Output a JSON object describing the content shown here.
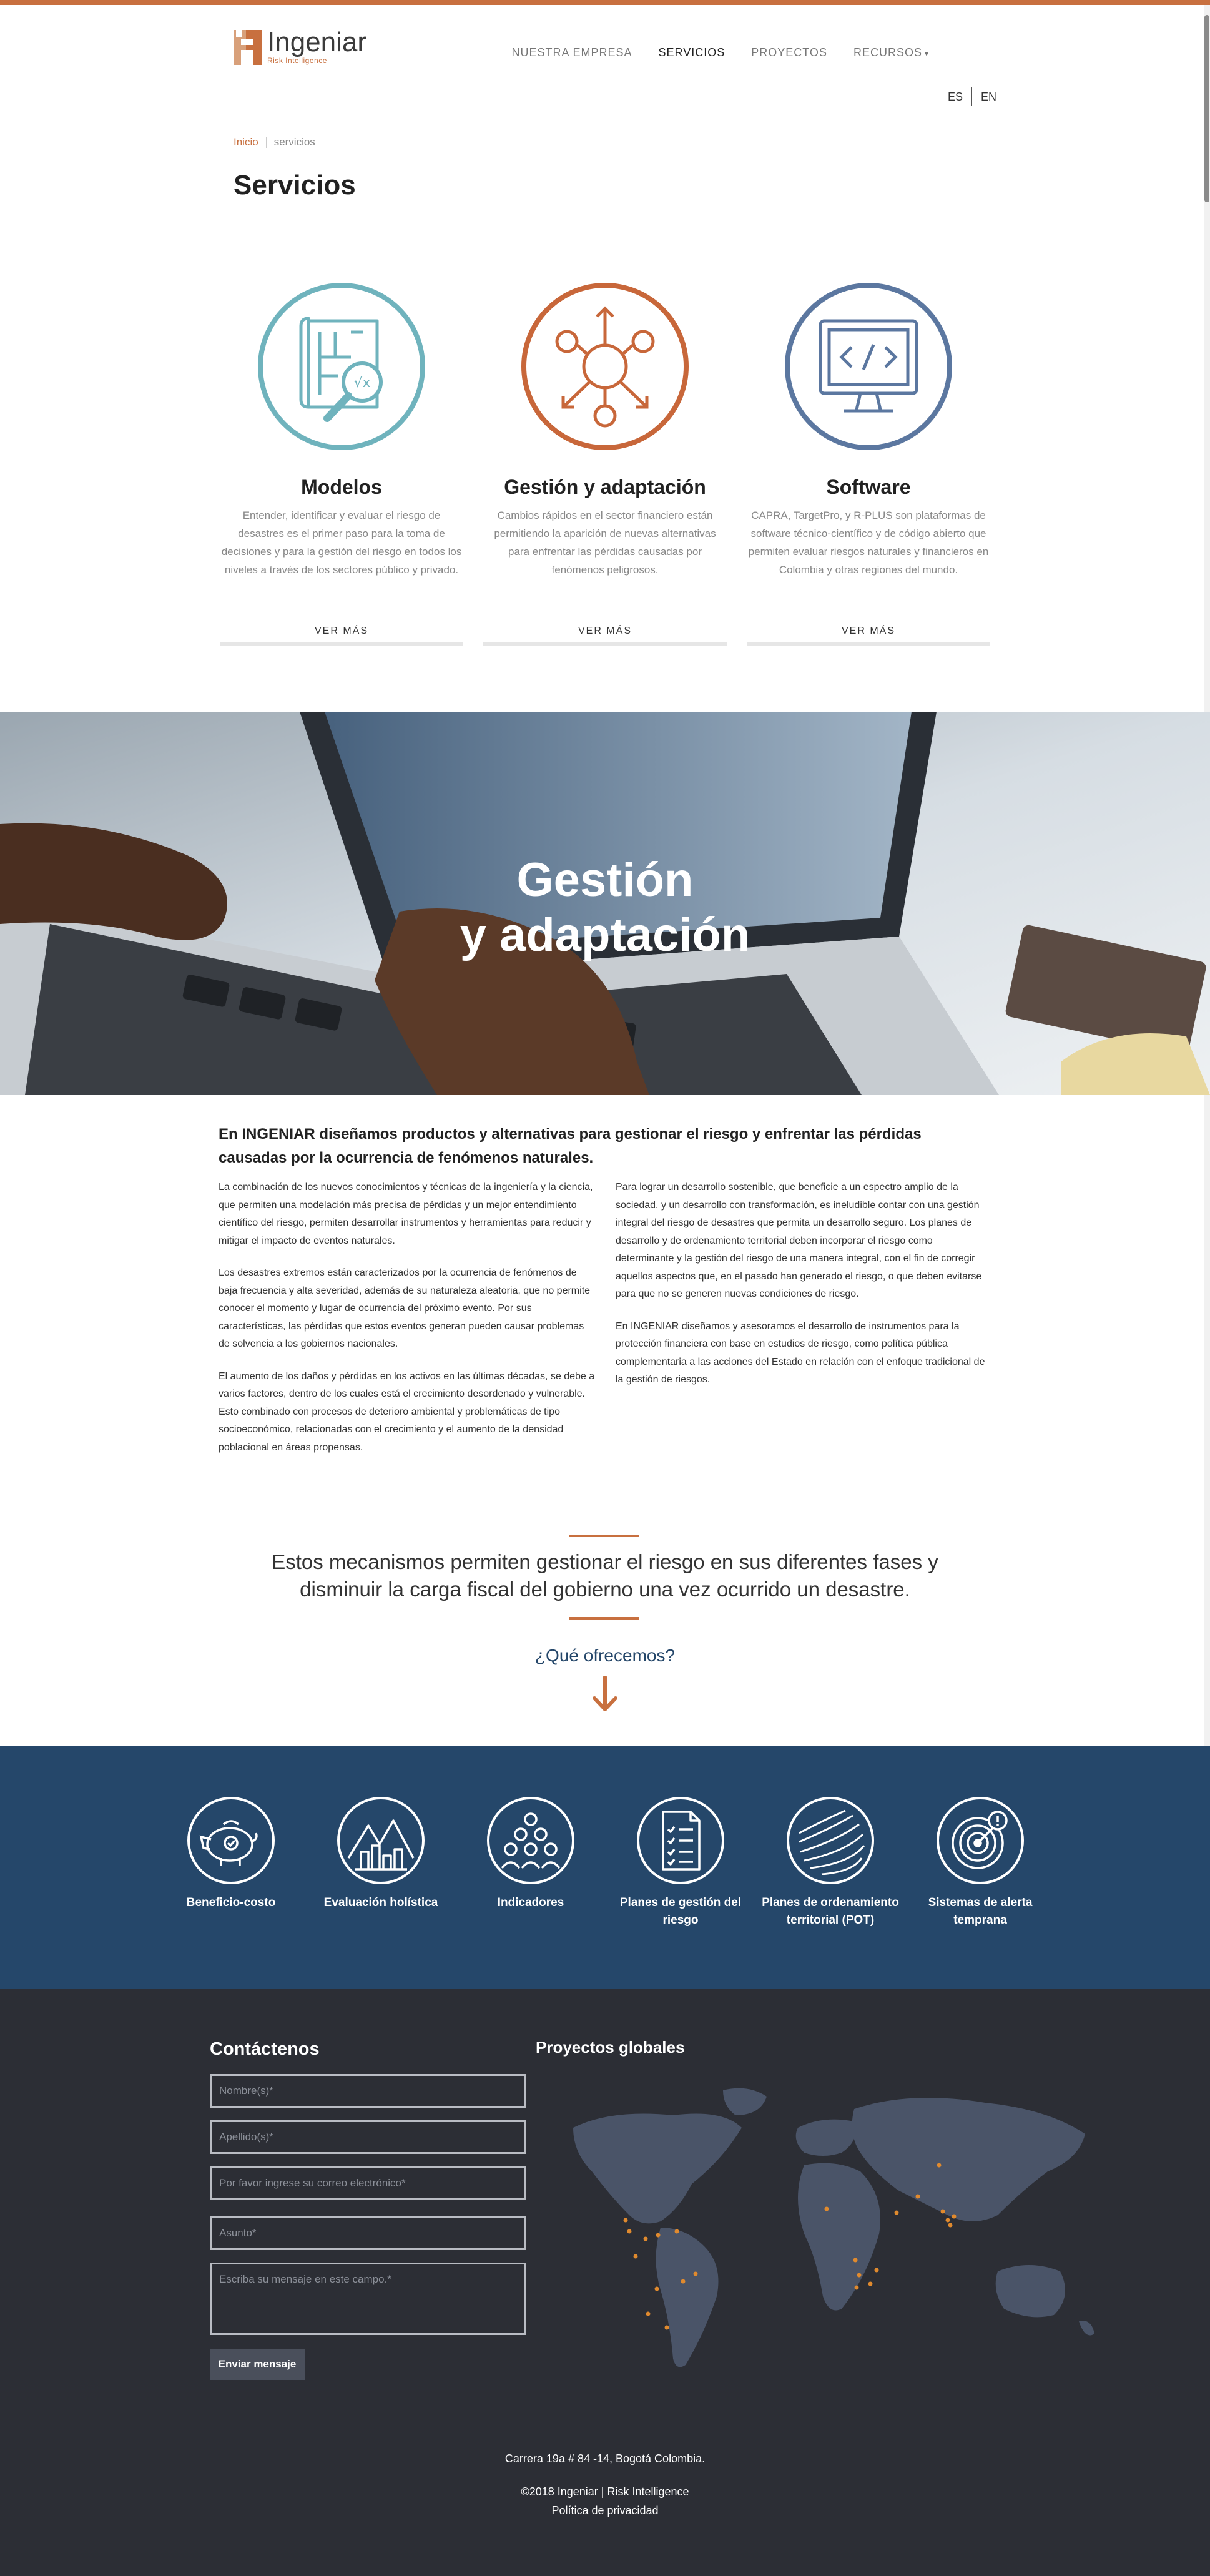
{
  "brand": {
    "name": "Ingeniar",
    "tagline": "Risk Intelligence",
    "accent_color": "#c8703f",
    "navy_color": "#25476a"
  },
  "nav": {
    "items": [
      {
        "label": "NUESTRA EMPRESA",
        "active": false
      },
      {
        "label": "SERVICIOS",
        "active": true
      },
      {
        "label": "PROYECTOS",
        "active": false
      },
      {
        "label": "RECURSOS",
        "active": false,
        "has_dropdown": true
      }
    ],
    "dropdown_icon": "chevron-down-icon"
  },
  "lang": {
    "es": "ES",
    "en": "EN"
  },
  "breadcrumb": {
    "home": "Inicio",
    "current": "servicios"
  },
  "page_title": "Servicios",
  "services": [
    {
      "icon": "blueprint-magnifier-icon",
      "color": "#6fb3bd",
      "title": "Modelos",
      "text": "Entender, identificar y evaluar el riesgo de desastres es el primer paso para la toma de decisiones y para la gestión del riesgo en todos los niveles a través de los sectores público y privado.",
      "button": "VER MÁS"
    },
    {
      "icon": "network-hub-icon",
      "color": "#c8673a",
      "title": "Gestión y adaptación",
      "text": "Cambios rápidos en el sector financiero están permitiendo la aparición de nuevas alternativas para enfrentar las pérdidas causadas por fenómenos peligrosos.",
      "button": "VER MÁS"
    },
    {
      "icon": "monitor-code-icon",
      "color": "#5b77a0",
      "title": "Software",
      "text": "CAPRA, TargetPro, y R-PLUS son plataformas de software técnico-científico y de código abierto que permiten evaluar riesgos naturales y financieros en Colombia y otras regiones del mundo.",
      "button": "VER MÁS"
    }
  ],
  "hero": {
    "line1": "Gestión",
    "line2": "y adaptación"
  },
  "article": {
    "lead": "En INGENIAR diseñamos productos y alternativas para gestionar el riesgo y enfrentar las pérdidas causadas por la ocurrencia de fenómenos naturales.",
    "left": [
      "La combinación de los nuevos conocimientos y técnicas de la ingeniería y la ciencia, que permiten una modelación más precisa de pérdidas y un mejor entendimiento científico del riesgo, permiten desarrollar instrumentos y herramientas para reducir y mitigar el impacto de eventos naturales.",
      "Los desastres extremos están caracterizados por la ocurrencia de fenómenos de baja frecuencia y alta severidad, además de su naturaleza aleatoria, que no permite conocer el momento y lugar de ocurrencia del próximo evento. Por sus características, las pérdidas que estos eventos generan pueden causar problemas de solvencia a los gobiernos nacionales.",
      "El aumento de los daños y pérdidas en los activos en las últimas décadas, se debe a varios factores, dentro de los cuales está el crecimiento desordenado y vulnerable. Esto combinado con procesos de deterioro ambiental y problemáticas de tipo socioeconómico, relacionadas con el crecimiento y el aumento de la densidad poblacional en áreas propensas."
    ],
    "right": [
      "Para lograr un desarrollo sostenible, que beneficie a un espectro amplio de la sociedad, y un desarrollo con transformación, es ineludible contar con una gestión integral del riesgo de desastres que permita un desarrollo seguro. Los planes de desarrollo y de ordenamiento territorial deben incorporar el riesgo como determinante y la gestión del riesgo de una manera integral, con el fin de corregir aquellos aspectos que, en el pasado han generado el riesgo, o que deben evitarse para que no se generen nuevas condiciones de riesgo.",
      "En INGENIAR diseñamos y asesoramos el desarrollo de instrumentos para la protección financiera con base en estudios de riesgo, como política pública complementaria a las acciones del Estado en relación con el enfoque tradicional de la gestión de riesgos."
    ],
    "quote": "Estos mecanismos permiten gestionar el riesgo en sus diferentes fases y disminuir la carga fiscal del gobierno una vez ocurrido un desastre.",
    "offer": "¿Qué ofrecemos?",
    "offer_icon": "arrow-down-icon"
  },
  "features": [
    {
      "label": "Beneficio-costo",
      "icon": "piggy-bank-icon"
    },
    {
      "label": "Evaluación holística",
      "icon": "city-mountains-icon"
    },
    {
      "label": "Indicadores",
      "icon": "people-group-icon"
    },
    {
      "label": "Planes de gestión del riesgo",
      "icon": "checklist-document-icon"
    },
    {
      "label": "Planes de ordenamiento territorial (POT)",
      "icon": "topographic-lines-icon"
    },
    {
      "label": "Sistemas de alerta temprana",
      "icon": "radar-alert-icon"
    }
  ],
  "contact": {
    "title": "Contáctenos",
    "first_name": "Nombre(s)*",
    "last_name": "Apellido(s)*",
    "email": "Por favor ingrese su correo electrónico*",
    "subject": "Asunto*",
    "message": "Escriba su mensaje en este campo.*",
    "submit": "Enviar mensaje"
  },
  "projects": {
    "title": "Proyectos globales",
    "marker_color": "#e08a2e"
  },
  "footer": {
    "address": "Carrera 19a # 84 -14, Bogotá Colombia.",
    "copyright": "©2018 Ingeniar | Risk Intelligence",
    "privacy": "Política de privacidad"
  }
}
